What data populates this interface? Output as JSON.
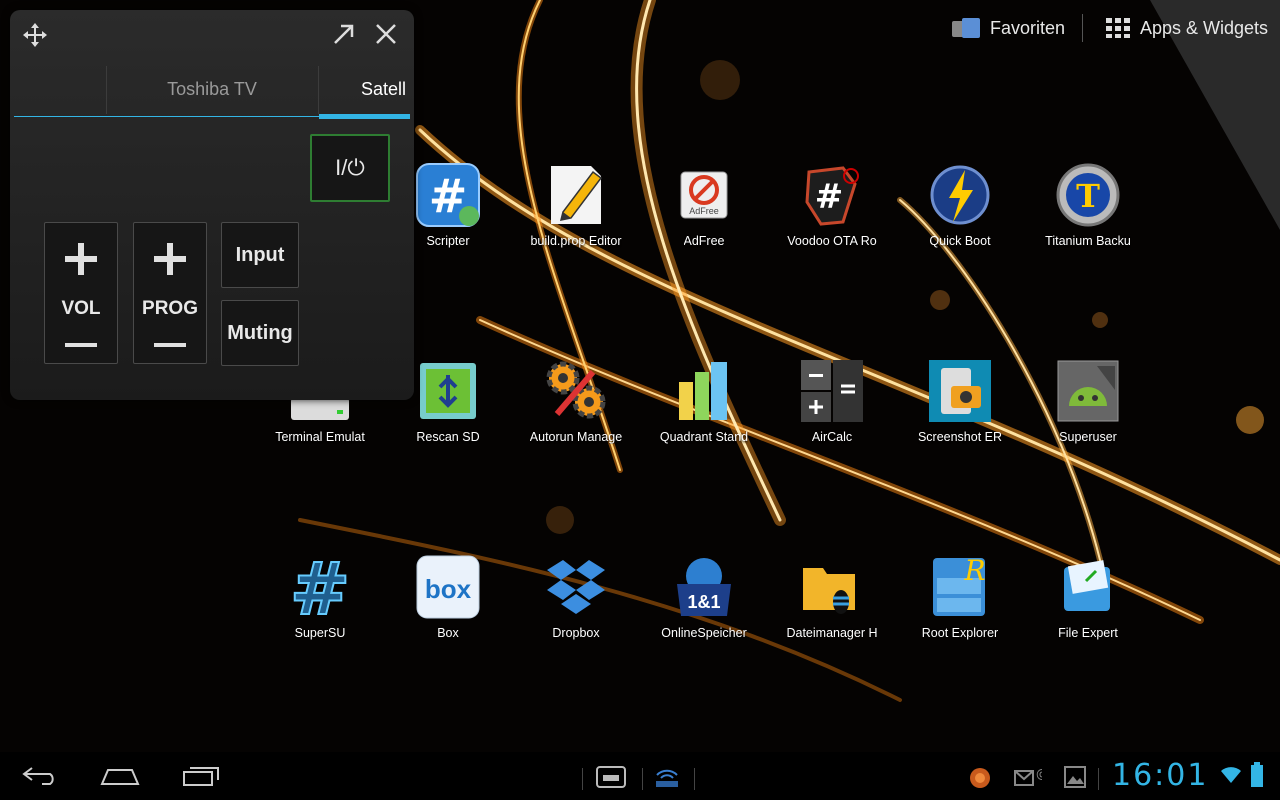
{
  "topbar": {
    "favorites_label": "Favoriten",
    "apps_widgets_label": "Apps & Widgets"
  },
  "remote": {
    "tabs": [
      {
        "label": ""
      },
      {
        "label": "Toshiba TV"
      },
      {
        "label": "Satell"
      }
    ],
    "power_label": "I/⏻",
    "vol_label": "VOL",
    "prog_label": "PROG",
    "input_label": "Input",
    "muting_label": "Muting"
  },
  "apps": [
    {
      "label": "Scripter",
      "icon": "scripter-icon"
    },
    {
      "label": "build.prop Editor",
      "icon": "build-prop-editor-icon"
    },
    {
      "label": "AdFree",
      "icon": "adfree-icon"
    },
    {
      "label": "Voodoo OTA Ro",
      "icon": "voodoo-ota-icon"
    },
    {
      "label": "Quick Boot",
      "icon": "quick-boot-icon"
    },
    {
      "label": "Titanium Backu",
      "icon": "titanium-backup-icon"
    },
    {
      "label": "Terminal Emulat",
      "icon": "terminal-emulator-icon"
    },
    {
      "label": "Rescan SD",
      "icon": "rescan-sd-icon"
    },
    {
      "label": "Autorun Manage",
      "icon": "autorun-manager-icon"
    },
    {
      "label": "Quadrant Stand",
      "icon": "quadrant-standard-icon"
    },
    {
      "label": "AirCalc",
      "icon": "aircalc-icon"
    },
    {
      "label": "Screenshot ER",
      "icon": "screenshot-er-icon"
    },
    {
      "label": "Superuser",
      "icon": "superuser-icon"
    },
    {
      "label": "SuperSU",
      "icon": "supersu-icon"
    },
    {
      "label": "Box",
      "icon": "box-icon"
    },
    {
      "label": "Dropbox",
      "icon": "dropbox-icon"
    },
    {
      "label": "OnlineSpeicher",
      "icon": "onlinespeicher-icon"
    },
    {
      "label": "Dateimanager H",
      "icon": "dateimanager-icon"
    },
    {
      "label": "Root Explorer",
      "icon": "root-explorer-icon"
    },
    {
      "label": "File Expert",
      "icon": "file-expert-icon"
    }
  ],
  "statusbar": {
    "clock": "16:01"
  },
  "colors": {
    "accent": "#33b5e5",
    "power_border": "#2e7d32"
  }
}
